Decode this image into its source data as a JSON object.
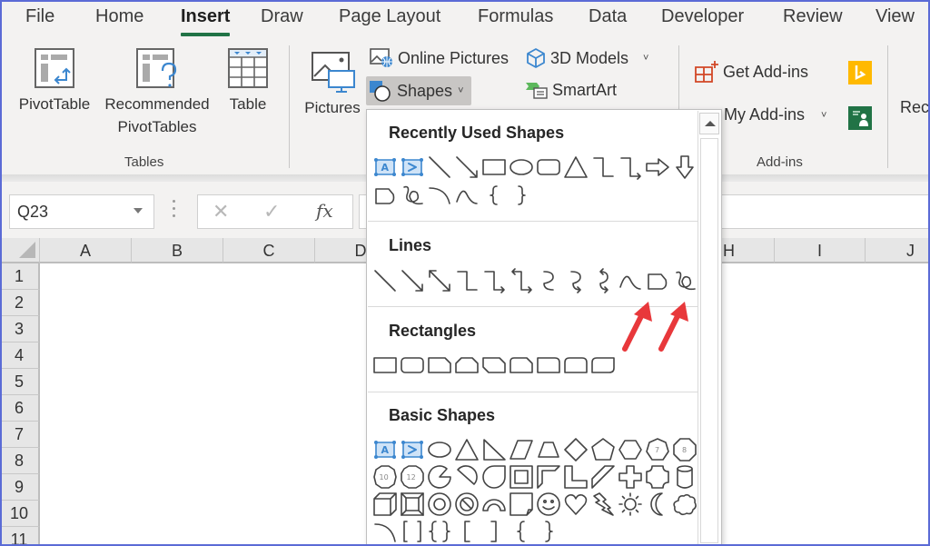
{
  "tabs": [
    {
      "label": "File",
      "active": false
    },
    {
      "label": "Home",
      "active": false
    },
    {
      "label": "Insert",
      "active": true
    },
    {
      "label": "Draw",
      "active": false
    },
    {
      "label": "Page Layout",
      "active": false
    },
    {
      "label": "Formulas",
      "active": false
    },
    {
      "label": "Data",
      "active": false
    },
    {
      "label": "Developer",
      "active": false
    },
    {
      "label": "Review",
      "active": false
    },
    {
      "label": "View",
      "active": false
    }
  ],
  "ribbon": {
    "tables_group": {
      "label": "Tables",
      "pivot_table": "PivotTable",
      "recommended_line1": "Recommended",
      "recommended_line2": "PivotTables",
      "table": "Table"
    },
    "illustrations": {
      "pictures": "Pictures",
      "online_pictures": "Online Pictures",
      "shapes": "Shapes",
      "models_3d": "3D Models",
      "smartart": "SmartArt"
    },
    "addins_group": {
      "label": "Add-ins",
      "get_addins": "Get Add-ins",
      "my_addins": "My Add-ins"
    },
    "truncated_next": "Rec"
  },
  "formula_bar": {
    "name_box": "Q23",
    "cancel_icon": "✕",
    "enter_icon": "✓",
    "fx_label": "fx",
    "formula_value": ""
  },
  "grid": {
    "columns": [
      "A",
      "B",
      "C",
      "D",
      "H",
      "I",
      "J"
    ],
    "rows": [
      "1",
      "2",
      "3",
      "4",
      "5",
      "6",
      "7",
      "8",
      "9",
      "10",
      "11"
    ]
  },
  "shapes_gallery": {
    "sections": [
      {
        "title": "Recently Used Shapes",
        "shape_count": 18
      },
      {
        "title": "Lines",
        "shape_count": 12
      },
      {
        "title": "Rectangles",
        "shape_count": 9
      },
      {
        "title": "Basic Shapes",
        "shape_count": 42
      }
    ],
    "annotated_shapes": [
      "Freeform: Shape",
      "Freeform: Scribble"
    ],
    "annotation_color": "#e8383b"
  },
  "colors": {
    "accent_green": "#217346",
    "frame_blue": "#5b6bd6",
    "icon_blue": "#3c87cf",
    "addins_orange": "#d24726",
    "bing_yellow": "#ffb900",
    "people_green": "#217346"
  }
}
